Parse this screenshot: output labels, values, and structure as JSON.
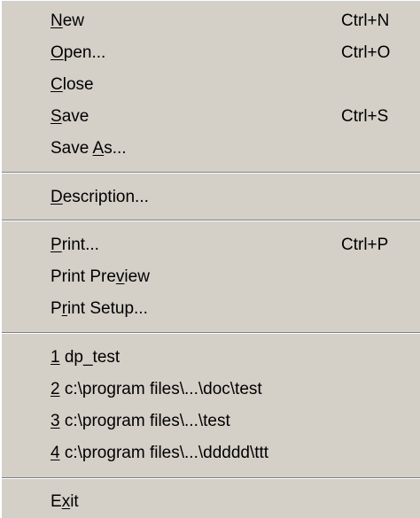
{
  "menu": {
    "items": [
      {
        "id": "new",
        "pre": "",
        "acc": "N",
        "post": "ew",
        "shortcut": "Ctrl+N"
      },
      {
        "id": "open",
        "pre": "",
        "acc": "O",
        "post": "pen...",
        "shortcut": "Ctrl+O"
      },
      {
        "id": "close",
        "pre": "",
        "acc": "C",
        "post": "lose",
        "shortcut": ""
      },
      {
        "id": "save",
        "pre": "",
        "acc": "S",
        "post": "ave",
        "shortcut": "Ctrl+S"
      },
      {
        "id": "save-as",
        "pre": "Save ",
        "acc": "A",
        "post": "s...",
        "shortcut": ""
      },
      {
        "id": "description",
        "pre": "",
        "acc": "D",
        "post": "escription...",
        "shortcut": ""
      },
      {
        "id": "print",
        "pre": "",
        "acc": "P",
        "post": "rint...",
        "shortcut": "Ctrl+P"
      },
      {
        "id": "print-preview",
        "pre": "Print Pre",
        "acc": "v",
        "post": "iew",
        "shortcut": ""
      },
      {
        "id": "print-setup",
        "pre": "P",
        "acc": "r",
        "post": "int Setup...",
        "shortcut": ""
      },
      {
        "id": "recent-1",
        "pre": "",
        "acc": "1",
        "post": " dp_test",
        "shortcut": ""
      },
      {
        "id": "recent-2",
        "pre": "",
        "acc": "2",
        "post": " c:\\program files\\...\\doc\\test",
        "shortcut": ""
      },
      {
        "id": "recent-3",
        "pre": "",
        "acc": "3",
        "post": " c:\\program files\\...\\test",
        "shortcut": ""
      },
      {
        "id": "recent-4",
        "pre": "",
        "acc": "4",
        "post": " c:\\program files\\...\\ddddd\\ttt",
        "shortcut": ""
      },
      {
        "id": "exit",
        "pre": "E",
        "acc": "x",
        "post": "it",
        "shortcut": ""
      }
    ]
  }
}
